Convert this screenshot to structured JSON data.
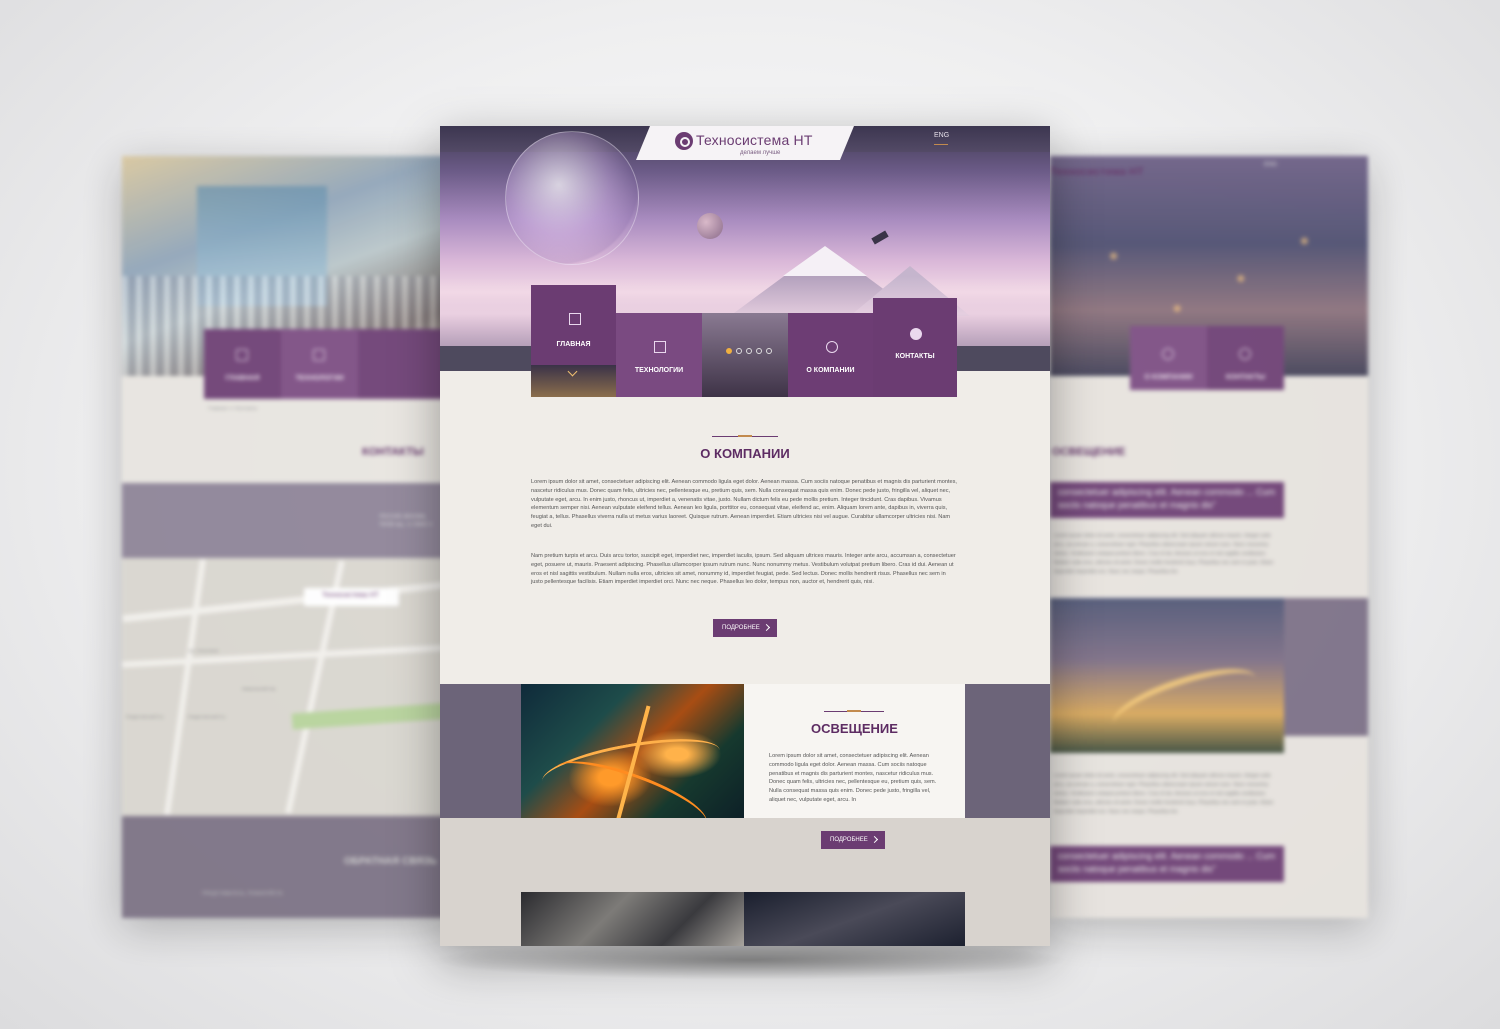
{
  "left_mockup": {
    "nav": [
      "ГЛАВНАЯ",
      "ТЕХНОЛОГИИ"
    ],
    "breadcrumb": "Главная >> Контакты",
    "title": "КОНТАКТЫ",
    "address": [
      "РОССИЯ, МОСКВА,",
      "ПХОВ пер., 4, ОФИС 4"
    ],
    "map_pin": "Техносистема НТ",
    "map_labels": [
      "Рождественский б-р",
      "Рождественский б-р",
      "пер. Печатников",
      "Камергерский пер."
    ],
    "footer_title": "ОБРАТНАЯ СВЯЗЬ",
    "footer_field": "ПРЕДСТАВЬТЕСЬ, ПОЖАЛУЙСТА"
  },
  "center": {
    "logo": {
      "name": "Техносистема НТ",
      "slogan": "делаем лучше"
    },
    "lang": "ENG",
    "nav": [
      {
        "label": "ГЛАВНАЯ",
        "icon": "home-icon"
      },
      {
        "label": "ТЕХНОЛОГИИ",
        "icon": "folder-icon"
      },
      {
        "label": "",
        "icon": ""
      },
      {
        "label": "О КОМПАНИИ",
        "icon": "link-icon"
      },
      {
        "label": "КОНТАКТЫ",
        "icon": "globe-icon"
      }
    ],
    "about": {
      "title": "О КОМПАНИИ",
      "p1": "Lorem ipsum dolor sit amet, consectetuer adipiscing elit. Aenean commodo ligula eget dolor. Aenean massa. Cum sociis natoque penatibus et magnis dis parturient montes, nascetur ridiculus mus. Donec quam felis, ultricies nec, pellentesque eu, pretium quis, sem. Nulla consequat massa quis enim. Donec pede justo, fringilla vel, aliquet nec, vulputate eget, arcu. In enim justo, rhoncus ut, imperdiet a, venenatis vitae, justo. Nullam dictum felis eu pede mollis pretium. Integer tincidunt. Cras dapibus. Vivamus elementum semper nisi. Aenean vulputate eleifend tellus. Aenean leo ligula, porttitor eu, consequat vitae, eleifend ac, enim. Aliquam lorem ante, dapibus in, viverra quis, feugiat a, tellus. Phasellus viverra nulla ut metus varius laoreet. Quisque rutrum. Aenean imperdiet. Etiam ultricies nisi vel augue. Curabitur ullamcorper ultricies nisi. Nam eget dui.",
      "p2": "Nam pretium turpis et arcu. Duis arcu tortor, suscipit eget, imperdiet nec, imperdiet iaculis, ipsum. Sed aliquam ultrices mauris. Integer ante arcu, accumsan a, consectetuer eget, posuere ut, mauris. Praesent adipiscing. Phasellus ullamcorper ipsum rutrum nunc. Nunc nonummy metus. Vestibulum volutpat pretium libero. Cras id dui. Aenean ut eros et nisl sagittis vestibulum. Nullam nulla eros, ultricies sit amet, nonummy id, imperdiet feugiat, pede. Sed lectus. Donec mollis hendrerit risus. Phasellus nec sem in justo pellentesque facilisis. Etiam imperdiet imperdiet orci. Nunc nec neque. Phasellus leo dolor, tempus non, auctor et, hendrerit quis, nisi.",
      "button": "ПОДРОБНЕЕ"
    },
    "lighting": {
      "title": "ОСВЕЩЕНИЕ",
      "text": "Lorem ipsum dolor sit amet, consectetuer adipiscing elit. Aenean commodo ligula eget dolor. Aenean massa. Cum sociis natoque penatibus et magnis dis parturient montes, nascetur ridiculus mus. Donec quam felis, ultricies nec, pellentesque eu, pretium quis, sem. Nulla consequat massa quis enim. Donec pede justo, fringilla vel, aliquet nec, vulputate eget, arcu. In",
      "button": "ПОДРОБНЕЕ"
    }
  },
  "right_mockup": {
    "logo": "Техносистема НТ",
    "lang": "ENG",
    "nav": [
      "О КОМПАНИИ",
      "КОНТАКТЫ"
    ],
    "title": "ОСВЕЩЕНИЕ",
    "quote": "consectetuer adipiscing elit. Aenean commodo ... Cum sociis natoque penatibus et magnis dis\"",
    "text": "Lorem ipsum dolor sit amet, consectetuer adipiscing elit. Sed aliquam ultrices mauris. Integer ante arcu, accumsan a, consectetuer eget. Phasellus ullamcorper ipsum rutrum nunc. Nunc nonummy metus. Vestibulum volutpat pretium libero. Cras id dui. Aenean ut eros et nisl sagittis vestibulum. Nullam nulla eros, ultricies sit amet. Donec mollis hendrerit risus. Phasellus nec sem in justo. Etiam imperdiet imperdiet orci. Nunc nec neque. Phasellus leo"
  },
  "colors": {
    "brand": "#6b3c72",
    "accent": "#c28a4e",
    "background": "#f0ede8"
  }
}
